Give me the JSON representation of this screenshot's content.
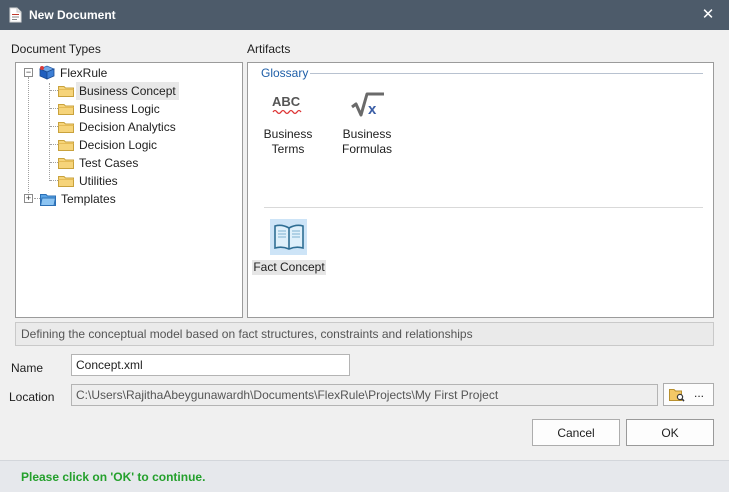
{
  "window": {
    "title": "New Document",
    "close_glyph": "✕"
  },
  "document_types": {
    "label": "Document Types",
    "root": {
      "label": "FlexRule",
      "expander": "−"
    },
    "items": [
      {
        "label": "Business Concept",
        "selected": true
      },
      {
        "label": "Business Logic"
      },
      {
        "label": "Decision Analytics"
      },
      {
        "label": "Decision Logic"
      },
      {
        "label": "Test Cases"
      },
      {
        "label": "Utilities"
      }
    ],
    "templates": {
      "label": "Templates",
      "expander": "+"
    }
  },
  "artifacts": {
    "label": "Artifacts",
    "group": "Glossary",
    "items": [
      {
        "line1": "Business",
        "line2": "Terms",
        "icon": "abc-spellcheck-icon",
        "icon_text": "ABC"
      },
      {
        "line1": "Business",
        "line2": "Formulas",
        "icon": "sqrt-x-icon",
        "icon_text": "√x"
      },
      {
        "line1": "Fact Concept",
        "icon": "open-book-icon",
        "selected": true
      }
    ]
  },
  "description": "Defining the conceptual model based on fact structures, constraints and relationships",
  "name_field": {
    "label": "Name",
    "value": "Concept.xml"
  },
  "location_field": {
    "label": "Location",
    "value": "C:\\Users\\RajithaAbeygunawardh\\Documents\\FlexRule\\Projects\\My First Project",
    "browse_label": "...",
    "browse_icon": "folder-search-icon"
  },
  "buttons": {
    "cancel": "Cancel",
    "ok": "OK"
  },
  "status": {
    "message": "Please click on 'OK' to continue."
  },
  "colors": {
    "titlebar": "#4d5b6a",
    "dialog_bg": "#f0f0f0",
    "group_title": "#1f5fa8",
    "status_text": "#24a02c",
    "selection": "#cde4f7"
  }
}
